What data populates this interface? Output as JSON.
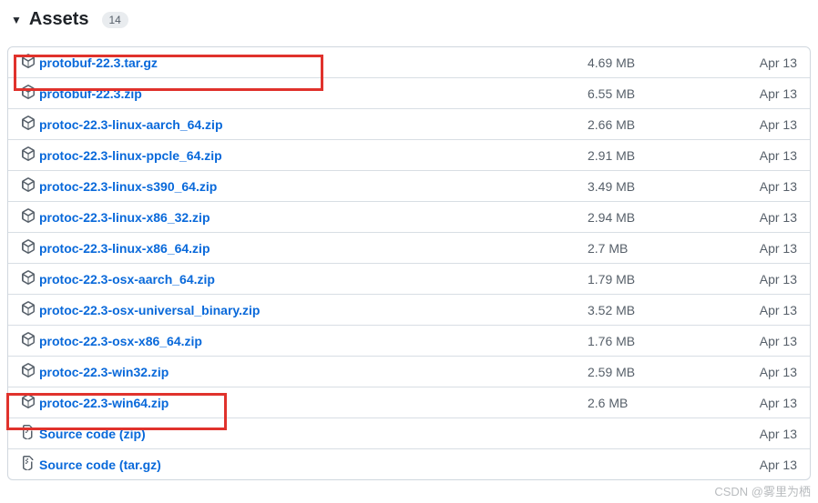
{
  "header": {
    "title": "Assets",
    "count": "14"
  },
  "assets": [
    {
      "name": "protobuf-22.3.tar.gz",
      "size": "4.69 MB",
      "date": "Apr 13",
      "icon": "package"
    },
    {
      "name": "protobuf-22.3.zip",
      "size": "6.55 MB",
      "date": "Apr 13",
      "icon": "package"
    },
    {
      "name": "protoc-22.3-linux-aarch_64.zip",
      "size": "2.66 MB",
      "date": "Apr 13",
      "icon": "package"
    },
    {
      "name": "protoc-22.3-linux-ppcle_64.zip",
      "size": "2.91 MB",
      "date": "Apr 13",
      "icon": "package"
    },
    {
      "name": "protoc-22.3-linux-s390_64.zip",
      "size": "3.49 MB",
      "date": "Apr 13",
      "icon": "package"
    },
    {
      "name": "protoc-22.3-linux-x86_32.zip",
      "size": "2.94 MB",
      "date": "Apr 13",
      "icon": "package"
    },
    {
      "name": "protoc-22.3-linux-x86_64.zip",
      "size": "2.7 MB",
      "date": "Apr 13",
      "icon": "package"
    },
    {
      "name": "protoc-22.3-osx-aarch_64.zip",
      "size": "1.79 MB",
      "date": "Apr 13",
      "icon": "package"
    },
    {
      "name": "protoc-22.3-osx-universal_binary.zip",
      "size": "3.52 MB",
      "date": "Apr 13",
      "icon": "package"
    },
    {
      "name": "protoc-22.3-osx-x86_64.zip",
      "size": "1.76 MB",
      "date": "Apr 13",
      "icon": "package"
    },
    {
      "name": "protoc-22.3-win32.zip",
      "size": "2.59 MB",
      "date": "Apr 13",
      "icon": "package"
    },
    {
      "name": "protoc-22.3-win64.zip",
      "size": "2.6 MB",
      "date": "Apr 13",
      "icon": "package"
    },
    {
      "name": "Source code (zip)",
      "size": "",
      "date": "Apr 13",
      "icon": "zip"
    },
    {
      "name": "Source code (tar.gz)",
      "size": "",
      "date": "Apr 13",
      "icon": "zip"
    }
  ],
  "watermark": "CSDN @雾里为栖"
}
